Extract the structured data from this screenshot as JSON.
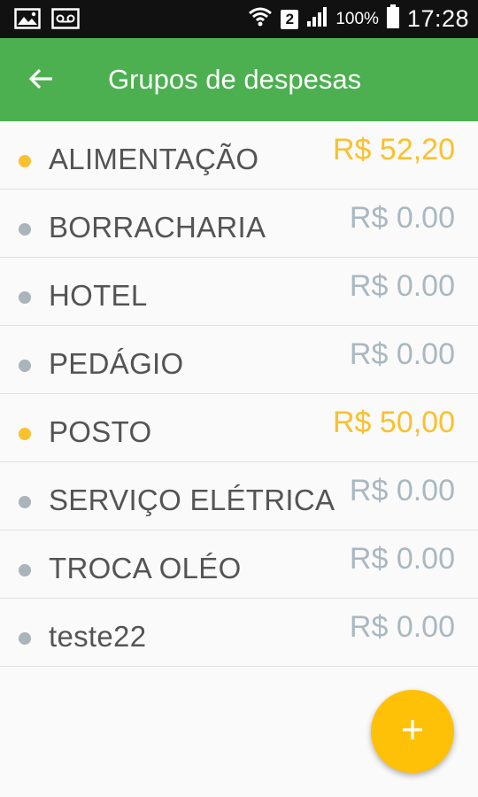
{
  "status_bar": {
    "left_icons": [
      "image-icon",
      "voicemail-icon"
    ],
    "sim_number": "2",
    "battery_percent": "100%",
    "time": "17:28"
  },
  "app_bar": {
    "title": "Grupos de despesas",
    "back_icon": "arrow-left-icon"
  },
  "colors": {
    "app_bar": "#4caf50",
    "active": "#fbc02d",
    "inactive_dot": "#aab4bb",
    "inactive_amount": "#aab8c0",
    "fab": "#ffc107"
  },
  "groups": [
    {
      "name": "ALIMENTAÇÃO",
      "amount": "R$ 52,20",
      "active": true
    },
    {
      "name": "BORRACHARIA",
      "amount": "R$ 0.00",
      "active": false
    },
    {
      "name": "HOTEL",
      "amount": "R$ 0.00",
      "active": false
    },
    {
      "name": "PEDÁGIO",
      "amount": "R$ 0.00",
      "active": false
    },
    {
      "name": "POSTO",
      "amount": "R$ 50,00",
      "active": true
    },
    {
      "name": "SERVIÇO ELÉTRICA",
      "amount": "R$ 0.00",
      "active": false
    },
    {
      "name": "TROCA OLÉO",
      "amount": "R$ 0.00",
      "active": false
    },
    {
      "name": "teste22",
      "amount": "R$ 0.00",
      "active": false
    }
  ],
  "fab": {
    "icon": "plus-icon"
  }
}
